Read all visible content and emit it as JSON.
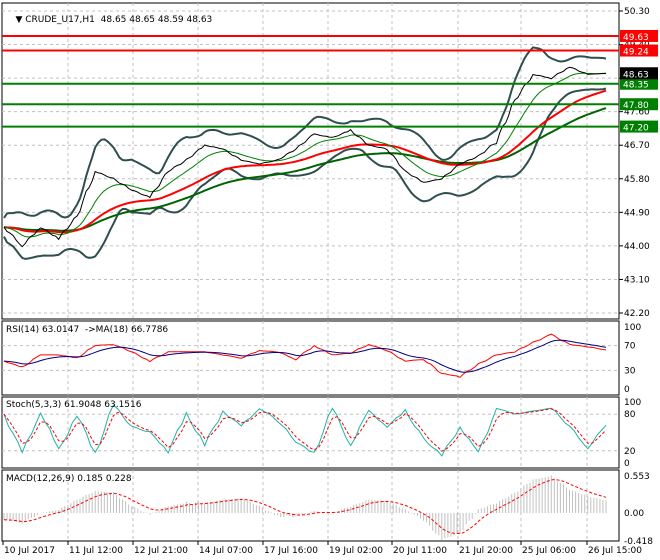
{
  "header": {
    "symbol_label": "CRUDE_U17,H1",
    "ohlc": "48.65 48.65 48.59 48.63"
  },
  "price_axis": {
    "ticks": [
      "50.30",
      "49.40",
      "48.50",
      "47.60",
      "46.70",
      "45.80",
      "44.90",
      "44.00",
      "43.10",
      "42.20"
    ]
  },
  "levels": [
    {
      "value": "49.63",
      "color": "#ff0000"
    },
    {
      "value": "49.24",
      "color": "#ff0000"
    },
    {
      "value": "48.35",
      "color": "#008000"
    },
    {
      "value": "47.80",
      "color": "#008000"
    },
    {
      "value": "47.20",
      "color": "#008000"
    }
  ],
  "current_price": {
    "value": "48.63",
    "color": "#000000"
  },
  "date_axis": {
    "ticks": [
      "10 Jul 2017",
      "11 Jul 12:00",
      "12 Jul 21:00",
      "14 Jul 07:00",
      "17 Jul 16:00",
      "19 Jul 02:00",
      "20 Jul 11:00",
      "21 Jul 20:00",
      "25 Jul 06:00",
      "26 Jul 15:00"
    ]
  },
  "rsi": {
    "label": "RSI(14) 63.0147  ->MA(18) 66.7786",
    "ticks": [
      "100",
      "70",
      "30",
      "0"
    ],
    "colors": {
      "rsi": "#ff0000",
      "ma": "#000080"
    }
  },
  "stoch": {
    "label": "Stoch(5,3,3) 61.9048 63.1516",
    "ticks": [
      "100",
      "80",
      "20",
      "0"
    ],
    "colors": {
      "main": "#20b2aa",
      "signal": "#ff0000"
    }
  },
  "macd": {
    "label": "MACD(12,26,9) 0.185 0.228",
    "ticks": [
      "0.553",
      "0.00",
      "-0.418"
    ],
    "colors": {
      "hist": "#c0c0c0",
      "signal": "#ff0000"
    }
  },
  "chart_data": [
    {
      "type": "line",
      "title": "CRUDE_U17,H1",
      "ylim": [
        42.2,
        50.3
      ],
      "grid": true,
      "series": [
        {
          "values": [
            44.5,
            44.0,
            44.5,
            44.2,
            44.8,
            46.0,
            45.8,
            45.5,
            45.3,
            46.0,
            46.3,
            46.7,
            46.6,
            46.3,
            46.2,
            46.3,
            46.6,
            47.0,
            46.9,
            47.1,
            46.7,
            46.6,
            46.0,
            45.7,
            45.8,
            46.2,
            46.4,
            46.8,
            47.9,
            48.6,
            48.5,
            48.8,
            48.6,
            48.63
          ]
        }
      ]
    },
    {
      "type": "line",
      "title": "RSI(14)",
      "ylim": [
        0,
        100
      ],
      "series": [
        {
          "values": [
            45,
            35,
            55,
            55,
            50,
            70,
            72,
            60,
            45,
            60,
            60,
            60,
            55,
            50,
            62,
            60,
            48,
            70,
            55,
            58,
            72,
            62,
            45,
            48,
            25,
            20,
            40,
            55,
            60,
            75,
            88,
            72,
            68,
            63
          ]
        }
      ]
    },
    {
      "type": "line",
      "title": "Stoch(5,3,3)",
      "ylim": [
        0,
        100
      ],
      "series": [
        {
          "values": [
            80,
            15,
            85,
            20,
            80,
            15,
            95,
            60,
            50,
            20,
            80,
            30,
            85,
            60,
            90,
            70,
            35,
            15,
            90,
            30,
            85,
            60,
            85,
            40,
            12,
            60,
            15,
            90,
            80,
            85,
            90,
            60,
            25,
            62
          ]
        }
      ]
    },
    {
      "type": "bar",
      "title": "MACD(12,26,9)",
      "ylim": [
        -0.418,
        0.553
      ],
      "series": [
        {
          "values": [
            -0.1,
            -0.15,
            0.0,
            0.05,
            0.2,
            0.33,
            0.3,
            0.1,
            -0.02,
            0.1,
            0.15,
            0.15,
            0.2,
            0.22,
            0.1,
            -0.05,
            -0.05,
            0.03,
            0.0,
            0.1,
            0.2,
            0.18,
            0.05,
            -0.1,
            -0.4,
            -0.3,
            0.05,
            0.15,
            0.3,
            0.5,
            0.55,
            0.35,
            0.25,
            0.185
          ]
        }
      ]
    }
  ]
}
